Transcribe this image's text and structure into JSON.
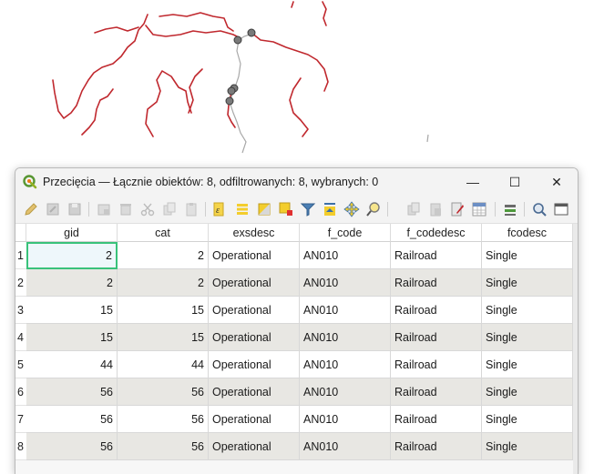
{
  "window": {
    "title": "Przecięcia — Łącznie obiektów: 8, odfiltrowanych: 8, wybranych: 0",
    "minimize_glyph": "—",
    "maximize_glyph": "☐",
    "close_glyph": "✕"
  },
  "toolbar": {
    "icons": [
      "pencil-edit-icon",
      "multi-edit-icon",
      "save-edits-icon",
      "reload-icon",
      "add-feature-icon",
      "delete-feature-icon",
      "cut-icon",
      "copy-icon",
      "paste-icon",
      "expression-select-icon",
      "select-all-icon",
      "invert-selection-icon",
      "deselect-all-icon",
      "filter-icon",
      "move-selection-top-icon",
      "pan-to-selection-icon",
      "zoom-to-selection-icon",
      "copy-cell-icon",
      "paste-cell-icon",
      "new-field-icon",
      "delete-field-icon",
      "field-calculator-icon",
      "conditional-formatting-icon",
      "actions-icon",
      "dock-icon"
    ]
  },
  "table": {
    "columns": [
      "gid",
      "cat",
      "exsdesc",
      "f_code",
      "f_codedesc",
      "fcodesc"
    ],
    "rows": [
      {
        "n": "1",
        "gid": "2",
        "cat": "2",
        "exsdesc": "Operational",
        "f_code": "AN010",
        "f_codedesc": "Railroad",
        "fcodesc": "Single"
      },
      {
        "n": "2",
        "gid": "2",
        "cat": "2",
        "exsdesc": "Operational",
        "f_code": "AN010",
        "f_codedesc": "Railroad",
        "fcodesc": "Single"
      },
      {
        "n": "3",
        "gid": "15",
        "cat": "15",
        "exsdesc": "Operational",
        "f_code": "AN010",
        "f_codedesc": "Railroad",
        "fcodesc": "Single"
      },
      {
        "n": "4",
        "gid": "15",
        "cat": "15",
        "exsdesc": "Operational",
        "f_code": "AN010",
        "f_codedesc": "Railroad",
        "fcodesc": "Single"
      },
      {
        "n": "5",
        "gid": "44",
        "cat": "44",
        "exsdesc": "Operational",
        "f_code": "AN010",
        "f_codedesc": "Railroad",
        "fcodesc": "Single"
      },
      {
        "n": "6",
        "gid": "56",
        "cat": "56",
        "exsdesc": "Operational",
        "f_code": "AN010",
        "f_codedesc": "Railroad",
        "fcodesc": "Single"
      },
      {
        "n": "7",
        "gid": "56",
        "cat": "56",
        "exsdesc": "Operational",
        "f_code": "AN010",
        "f_codedesc": "Railroad",
        "fcodesc": "Single"
      },
      {
        "n": "8",
        "gid": "56",
        "cat": "56",
        "exsdesc": "Operational",
        "f_code": "AN010",
        "f_codedesc": "Railroad",
        "fcodesc": "Single"
      }
    ]
  },
  "colors": {
    "river": "#c0282e",
    "railroad": "#a8a8a8",
    "point_fill": "#7a7a7a",
    "selection_border": "#39c27a",
    "row_alt": "#e8e7e3"
  }
}
